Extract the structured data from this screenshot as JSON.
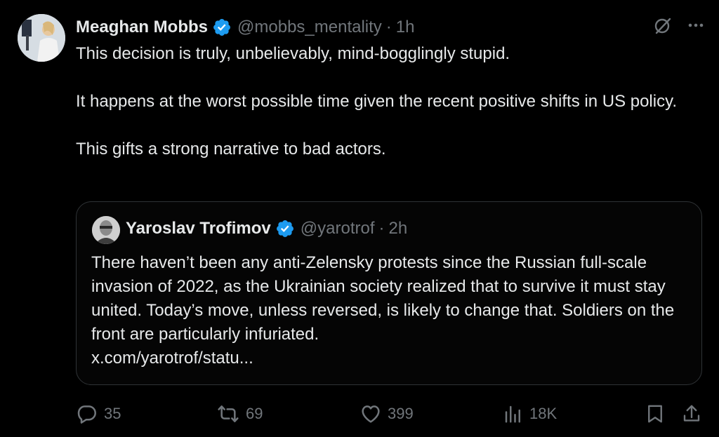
{
  "tweet": {
    "author_name": "Meaghan Mobbs",
    "handle": "@mobbs_mentality",
    "separator": "·",
    "time": "1h",
    "paragraphs": [
      "This decision is truly, unbelievably, mind-bogglingly stupid.",
      "It happens at the worst possible time given the recent positive shifts in US policy.",
      "This gifts a strong narrative to bad actors."
    ]
  },
  "quote": {
    "author_name": "Yaroslav Trofimov",
    "handle": "@yarotrof",
    "separator": "·",
    "time": "2h",
    "text": "There haven’t been any anti-Zelensky protests since the Russian full-scale invasion of 2022, as the Ukrainian society realized that to survive it must stay united. Today’s move, unless reversed, is likely to change that. Soldiers on the front are particularly infuriated.",
    "link": "x.com/yarotrof/statu..."
  },
  "actions": {
    "replies": "35",
    "reposts": "69",
    "likes": "399",
    "views": "18K"
  },
  "icons": {
    "top_right": [
      "grok-icon",
      "more-icon"
    ],
    "action_bar": [
      "reply-icon",
      "repost-icon",
      "like-icon",
      "views-icon",
      "bookmark-icon",
      "share-icon"
    ]
  },
  "colors": {
    "background": "#000000",
    "text": "#e7e9ea",
    "muted": "#71767b",
    "border": "#2f3336",
    "verified": "#1d9bf0"
  }
}
